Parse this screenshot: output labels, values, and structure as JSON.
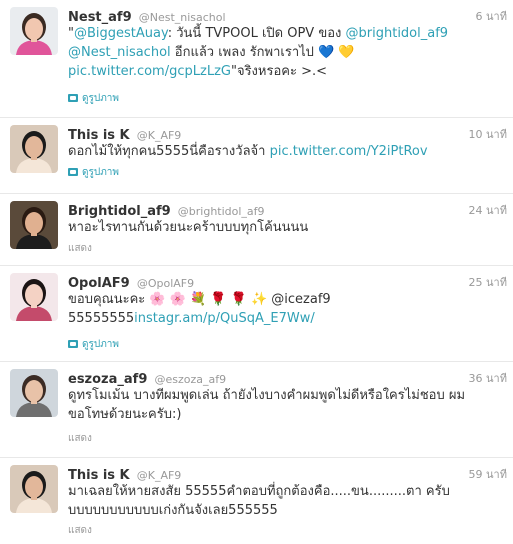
{
  "tweets": [
    {
      "name": "Nest_af9",
      "handle": "@Nest_nisachol",
      "time": "6 นาที",
      "parts": [
        {
          "t": "\"",
          "link": false
        },
        {
          "t": "@BiggestAuay",
          "link": true
        },
        {
          "t": ": วันนี้ TVPOOL เปิด OPV ของ ",
          "link": false
        },
        {
          "t": "@brightidol_af9",
          "link": true
        },
        {
          "t": " ",
          "link": false
        },
        {
          "t": "@Nest_nisachol",
          "link": true
        },
        {
          "t": " อีกแล้ว เพลง รักพาเราไป ",
          "link": false
        },
        {
          "t": "💙 💛",
          "link": false
        },
        {
          "t": " ",
          "link": false
        },
        {
          "t": "pic.twitter.com/gcpLzLzG",
          "link": true
        },
        {
          "t": "\"จริงหรอคะ >.<",
          "link": false
        }
      ],
      "action": "ดูรูปภาพ",
      "action_type": "photo",
      "avatar_colors": {
        "bg": "#e9ecef",
        "skin": "#f1c7b0",
        "hair": "#3a2a22",
        "body": "#e0559a"
      }
    },
    {
      "name": "This is K",
      "handle": "@K_AF9",
      "time": "10 นาที",
      "parts": [
        {
          "t": "ดอกไม้ให้ทุกคน5555นี่คือรางวัลจ้า ",
          "link": false
        },
        {
          "t": "pic.twitter.com/Y2iPtRov",
          "link": true
        }
      ],
      "action": "ดูรูปภาพ",
      "action_type": "photo",
      "avatar_colors": {
        "bg": "#d9c9b9",
        "skin": "#e2b79a",
        "hair": "#1a1a1a",
        "body": "#f4e6d8"
      }
    },
    {
      "name": "Brightidol_af9",
      "handle": "@brightidol_af9",
      "time": "24 นาที",
      "parts": [
        {
          "t": "หาอะไรทานกันด้วยนะคร้าบบบทุกโค้นนนน",
          "link": false
        }
      ],
      "action": "แสดง",
      "action_type": "plain",
      "avatar_colors": {
        "bg": "#5a4a3a",
        "skin": "#e0b090",
        "hair": "#2a1a12",
        "body": "#1d1d1d"
      }
    },
    {
      "name": "OpolAF9",
      "handle": "@OpolAF9",
      "time": "25 นาที",
      "parts": [
        {
          "t": "ขอบคุณนะคะ 🌸 🌸 💐 🌹 🌹 ✨ @icezaf9 55555555",
          "link": false
        },
        {
          "t": "instagr.am/p/QuSqA_E7Ww/",
          "link": true
        }
      ],
      "action": "ดูรูปภาพ",
      "action_type": "photo",
      "avatar_colors": {
        "bg": "#f3e7ea",
        "skin": "#f4d2c4",
        "hair": "#1b1414",
        "body": "#c44b6b"
      }
    },
    {
      "name": "eszoza_af9",
      "handle": "@eszoza_af9",
      "time": "36 นาที",
      "parts": [
        {
          "t": "ดูทรโมเม้น บางทีผมพูดเล่น ถ้ายังไงบางคำผมพูดไม่ดีหรือใครไม่ชอบ ผมขอโทษด้วยนะครับ:)",
          "link": false
        }
      ],
      "action": "แสดง",
      "action_type": "plain",
      "avatar_colors": {
        "bg": "#cfd6dc",
        "skin": "#e8c2a8",
        "hair": "#3b2b24",
        "body": "#6f6f6f"
      }
    },
    {
      "name": "This is K",
      "handle": "@K_AF9",
      "time": "59 นาที",
      "parts": [
        {
          "t": "มาเฉลยให้หายสงสัย 55555คำตอบที่ถูกต้องคือ.....ขน.........ตา ครับบบบบบบบบบบบเก่งกันจังเลย555555",
          "link": false
        }
      ],
      "action": "แสดง",
      "action_type": "plain",
      "avatar_colors": {
        "bg": "#d9c9b9",
        "skin": "#e2b79a",
        "hair": "#1a1a1a",
        "body": "#f4e6d8"
      }
    }
  ],
  "colors": {
    "link": "#2fa0b5",
    "muted": "#999999",
    "text": "#333333"
  }
}
